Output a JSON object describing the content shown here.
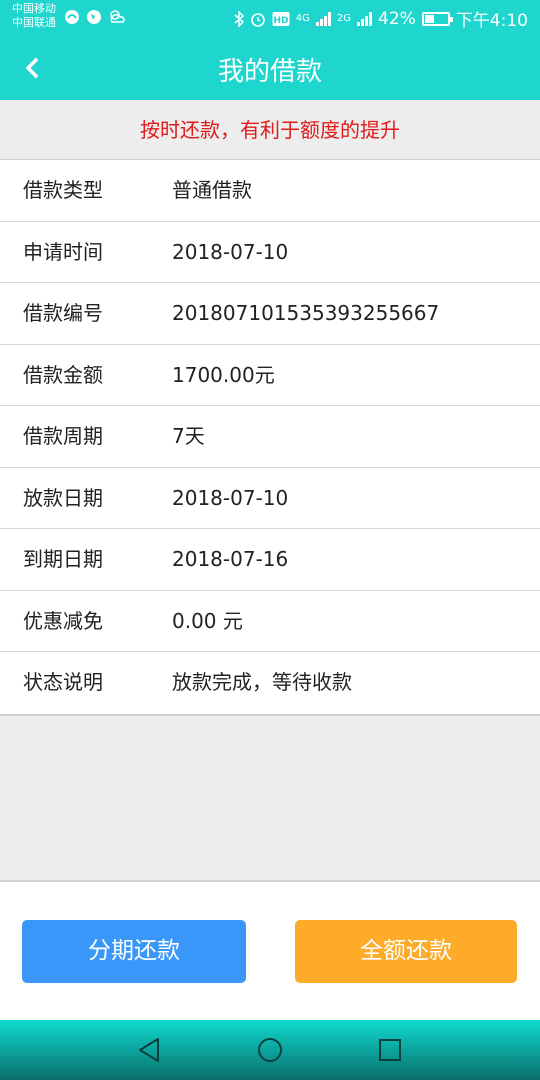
{
  "status_bar": {
    "carrier_1": "中国移动",
    "carrier_2": "中国联通",
    "net_4g": "4G",
    "net_2g": "2G",
    "battery_percent": "42%",
    "battery_level": 0.42,
    "time": "下午4:10"
  },
  "header": {
    "title": "我的借款",
    "back_icon": "chevron-left-icon"
  },
  "notice": "按时还款，有利于额度的提升",
  "details": [
    {
      "label": "借款类型",
      "value": "普通借款"
    },
    {
      "label": "申请时间",
      "value": "2018-07-10"
    },
    {
      "label": "借款编号",
      "value": "201807101535393255667"
    },
    {
      "label": "借款金额",
      "value": "1700.00元"
    },
    {
      "label": "借款周期",
      "value": "7天"
    },
    {
      "label": "放款日期",
      "value": "2018-07-10"
    },
    {
      "label": "到期日期",
      "value": "2018-07-16"
    },
    {
      "label": "优惠减免",
      "value": "0.00 元"
    },
    {
      "label": "状态说明",
      "value": "放款完成，等待收款"
    }
  ],
  "actions": {
    "installment": "分期还款",
    "full": "全额还款"
  },
  "colors": {
    "theme": "#1fd6cf",
    "notice_text": "#e11a1a",
    "installment_button": "#3997fa",
    "full_button": "#fdab29"
  }
}
